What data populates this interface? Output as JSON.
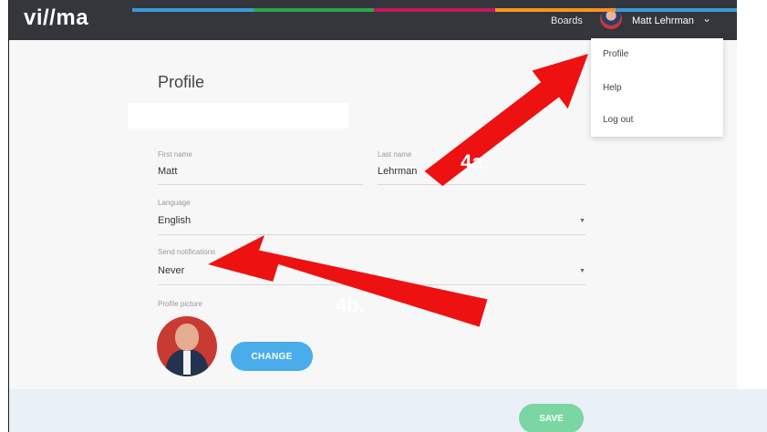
{
  "app": {
    "logo": "vi//ma"
  },
  "header": {
    "boards_label": "Boards",
    "user_name": "Matt Lehrman"
  },
  "brand_strip_colors": [
    "#3a9ad9",
    "#2aa64a",
    "#c2185b",
    "#f7941d",
    "#3a9ad9"
  ],
  "menu": {
    "items": [
      {
        "label": "Profile"
      },
      {
        "label": "Help"
      },
      {
        "label": "Log out"
      }
    ]
  },
  "profile": {
    "title": "Profile",
    "first_name": {
      "label": "First name",
      "value": "Matt"
    },
    "last_name": {
      "label": "Last name",
      "value": "Lehrman"
    },
    "language": {
      "label": "Language",
      "value": "English"
    },
    "notifications": {
      "label": "Send notifications",
      "value": "Never"
    },
    "picture_label": "Profile picture",
    "change_label": "CHANGE",
    "save_label": "SAVE"
  },
  "annotations": {
    "a": "4a.",
    "b": "4b.",
    "arrow_color": "#ee1111"
  },
  "colors": {
    "topbar": "#34363c",
    "change_button": "#4aacea",
    "save_button": "#7ad6a2"
  }
}
